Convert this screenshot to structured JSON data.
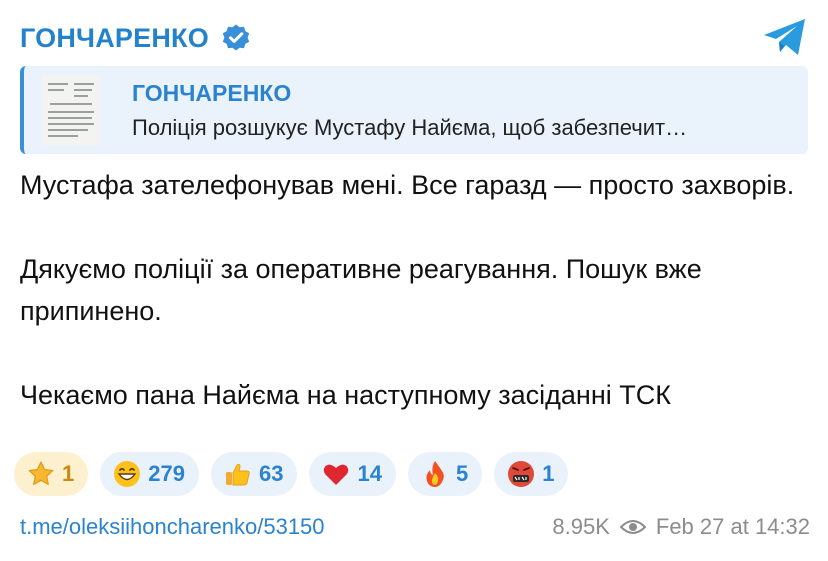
{
  "header": {
    "channel_name": "ГОНЧАРЕНКО",
    "verified_icon": "verified-badge-icon",
    "logo_icon": "telegram-logo-icon",
    "accent": "#2481cc"
  },
  "reply": {
    "title": "ГОНЧАРЕНКО",
    "text": "Поліція розшукує Мустафу Найєма, щоб забезпечит…",
    "thumbnail_icon": "document-thumbnail-icon"
  },
  "message": {
    "paragraphs": [
      "Мустафа зателефонував мені. Все гаразд — просто захворів.",
      "Дякуємо поліції за оперативне реагування. Пошук вже припинено.",
      "Чекаємо пана Найєма на наступному засіданні ТСК"
    ]
  },
  "reactions": [
    {
      "icon": "star-icon",
      "count": "1"
    },
    {
      "icon": "grinning-face-icon",
      "count": "279"
    },
    {
      "icon": "thumbs-up-icon",
      "count": "63"
    },
    {
      "icon": "red-heart-icon",
      "count": "14"
    },
    {
      "icon": "fire-icon",
      "count": "5"
    },
    {
      "icon": "cursing-face-icon",
      "count": "1"
    }
  ],
  "footer": {
    "link": "t.me/oleksiihoncharenko/53150",
    "views": "8.95K",
    "views_icon": "eye-icon",
    "date": "Feb 27 at 14:32"
  }
}
